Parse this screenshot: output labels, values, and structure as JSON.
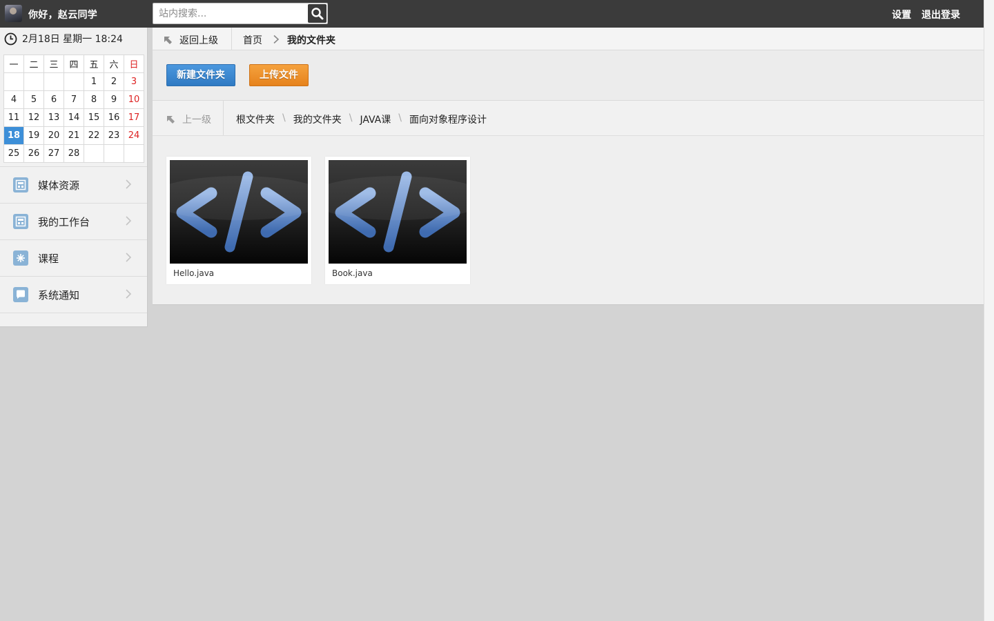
{
  "topbar": {
    "greeting": "你好，赵云同学",
    "search_placeholder": "站内搜索...",
    "settings": "设置",
    "logout": "退出登录"
  },
  "sidebar": {
    "datetime": "2月18日 星期一 18:24",
    "calendar": {
      "weekdays": [
        "一",
        "二",
        "三",
        "四",
        "五",
        "六",
        "日"
      ],
      "weeks": [
        [
          "",
          "",
          "",
          "",
          "1",
          "2",
          "3"
        ],
        [
          "4",
          "5",
          "6",
          "7",
          "8",
          "9",
          "10"
        ],
        [
          "11",
          "12",
          "13",
          "14",
          "15",
          "16",
          "17"
        ],
        [
          "18",
          "19",
          "20",
          "21",
          "22",
          "23",
          "24"
        ],
        [
          "25",
          "26",
          "27",
          "28",
          "",
          "",
          ""
        ]
      ],
      "today": "18"
    },
    "items": [
      {
        "label": "媒体资源",
        "icon": "media-icon"
      },
      {
        "label": "我的工作台",
        "icon": "workbench-icon"
      },
      {
        "label": "课程",
        "icon": "course-icon"
      },
      {
        "label": "系统通知",
        "icon": "notification-icon"
      }
    ]
  },
  "breadcrumb": {
    "back": "返回上级",
    "home": "首页",
    "current": "我的文件夹"
  },
  "toolbar": {
    "new_folder": "新建文件夹",
    "upload": "上传文件"
  },
  "path": {
    "up": "上一级",
    "segments": [
      "根文件夹",
      "我的文件夹",
      "JAVA课",
      "面向对象程序设计"
    ]
  },
  "files": [
    {
      "name": "Hello.java",
      "icon": "code-file-icon"
    },
    {
      "name": "Book.java",
      "icon": "code-file-icon"
    }
  ],
  "colors": {
    "topbar": "#3b3b3b",
    "today_highlight": "#3d8fd8",
    "sunday": "#dd2222",
    "btn_blue": "#3d8ad1",
    "btn_orange": "#ee9230"
  }
}
